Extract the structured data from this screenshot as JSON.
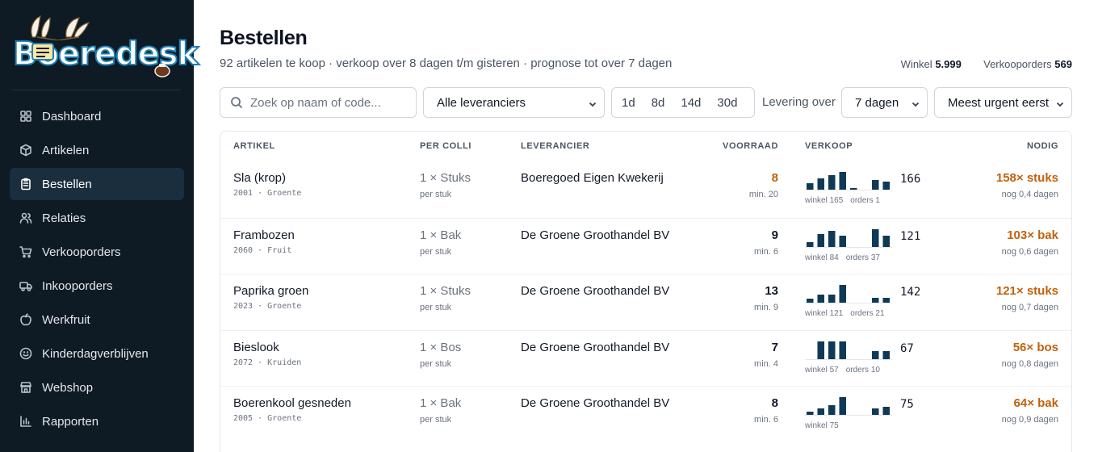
{
  "app": {
    "logo_text": "Boeredesk"
  },
  "colors": {
    "sidebar_bg": "#0e1a24",
    "accent_orange": "#c2610c",
    "bar_navy": "#0f3a57"
  },
  "sidebar": {
    "items": [
      {
        "label": "Dashboard",
        "icon": "dashboard-icon"
      },
      {
        "label": "Artikelen",
        "icon": "box-icon"
      },
      {
        "label": "Bestellen",
        "icon": "clipboard-icon",
        "active": true
      },
      {
        "label": "Relaties",
        "icon": "users-icon"
      },
      {
        "label": "Verkooporders",
        "icon": "cart-icon"
      },
      {
        "label": "Inkooporders",
        "icon": "truck-icon"
      },
      {
        "label": "Werkfruit",
        "icon": "apple-icon"
      },
      {
        "label": "Kinderdagverblijven",
        "icon": "smiley-icon"
      },
      {
        "label": "Webshop",
        "icon": "store-icon"
      },
      {
        "label": "Rapporten",
        "icon": "chart-icon"
      }
    ]
  },
  "header": {
    "title": "Bestellen",
    "subtitle": "92 artikelen te koop · verkoop over 8 dagen t/m gisteren · prognose tot over 7 dagen",
    "winkel_label": "Winkel",
    "winkel_value": "5.999",
    "verkooporders_label": "Verkooporders",
    "verkooporders_value": "569"
  },
  "toolbar": {
    "search_placeholder": "Zoek op naam of code...",
    "supplier_select": "Alle leveranciers",
    "periods": [
      "1d",
      "8d",
      "14d",
      "30d"
    ],
    "delivery_label": "Levering over",
    "delivery_select": "7 dagen",
    "sort_select": "Meest urgent eerst"
  },
  "table": {
    "headers": {
      "artikel": "ARTIKEL",
      "per_colli": "PER COLLI",
      "leverancier": "LEVERANCIER",
      "voorraad": "VOORRAAD",
      "verkoop": "VERKOOP",
      "nodig": "NODIG"
    },
    "rows": [
      {
        "name": "Sla (krop)",
        "code": "2001 · Groente",
        "colli": "1 × Stuks",
        "colli_sub": "per stuk",
        "supplier": "Boeregoed Eigen Kwekerij",
        "stock": "8",
        "stock_warn": true,
        "stock_min": "min. 20",
        "sales": [
          8,
          14,
          18,
          22,
          2,
          0,
          12,
          10
        ],
        "sales_total": "166",
        "winkel": "winkel 165",
        "orders": "orders 1",
        "need": "158× stuks",
        "need_sub": "nog 0,4 dagen"
      },
      {
        "name": "Frambozen",
        "code": "2060 · Fruit",
        "colli": "1 × Bak",
        "colli_sub": "per stuk",
        "supplier": "De Groene Groothandel BV",
        "stock": "9",
        "stock_warn": false,
        "stock_min": "min. 6",
        "sales": [
          6,
          16,
          20,
          14,
          0,
          0,
          22,
          14
        ],
        "sales_total": "121",
        "winkel": "winkel 84",
        "orders": "orders 37",
        "need": "103× bak",
        "need_sub": "nog 0,6 dagen"
      },
      {
        "name": "Paprika groen",
        "code": "2023 · Groente",
        "colli": "1 × Stuks",
        "colli_sub": "per stuk",
        "supplier": "De Groene Groothandel BV",
        "stock": "13",
        "stock_warn": false,
        "stock_min": "min. 9",
        "sales": [
          5,
          10,
          10,
          22,
          0,
          0,
          6,
          6
        ],
        "sales_total": "142",
        "winkel": "winkel 121",
        "orders": "orders 21",
        "need": "121× stuks",
        "need_sub": "nog 0,7 dagen"
      },
      {
        "name": "Bieslook",
        "code": "2072 · Kruiden",
        "colli": "1 × Bos",
        "colli_sub": "per stuk",
        "supplier": "De Groene Groothandel BV",
        "stock": "7",
        "stock_warn": false,
        "stock_min": "min. 4",
        "sales": [
          0,
          22,
          22,
          22,
          0,
          0,
          10,
          10
        ],
        "sales_total": "67",
        "winkel": "winkel 57",
        "orders": "orders 10",
        "need": "56× bos",
        "need_sub": "nog 0,8 dagen"
      },
      {
        "name": "Boerenkool gesneden",
        "code": "2005 · Groente",
        "colli": "1 × Bak",
        "colli_sub": "per stuk",
        "supplier": "De Groene Groothandel BV",
        "stock": "8",
        "stock_warn": false,
        "stock_min": "min. 6",
        "sales": [
          4,
          8,
          12,
          22,
          0,
          0,
          8,
          10
        ],
        "sales_total": "75",
        "winkel": "winkel 75",
        "orders": "",
        "need": "64× bak",
        "need_sub": "nog 0,9 dagen"
      }
    ]
  }
}
